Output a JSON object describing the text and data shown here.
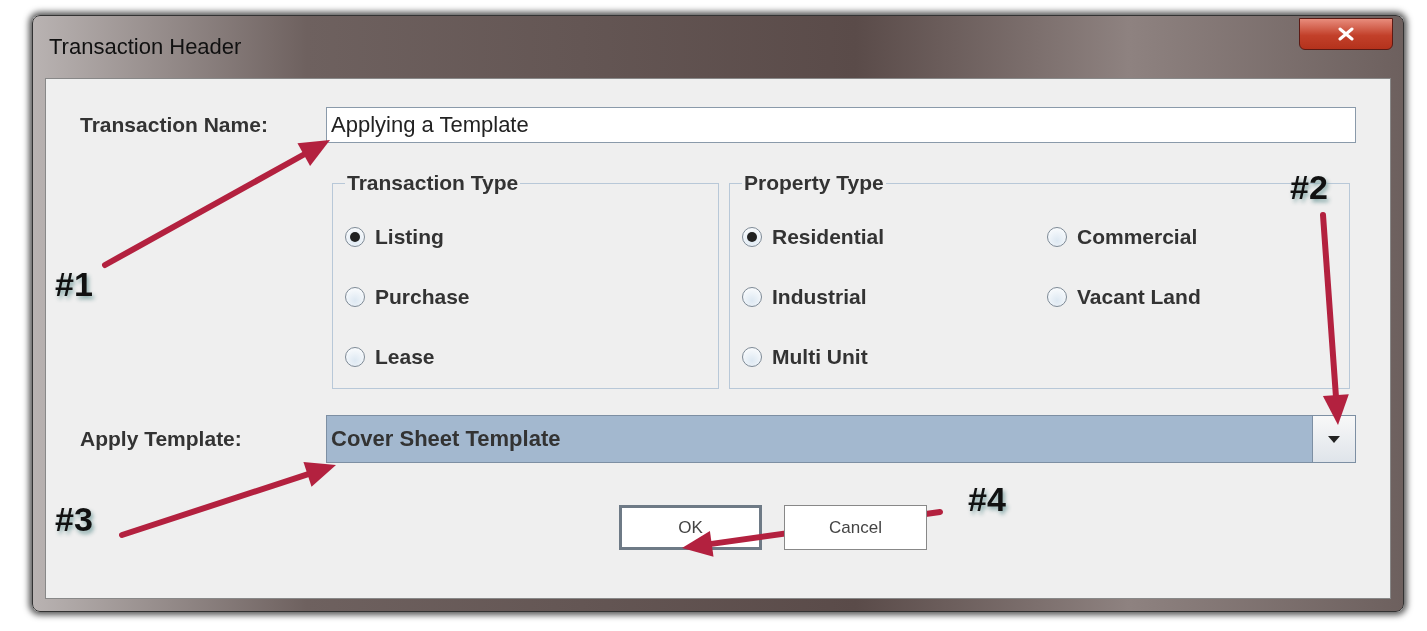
{
  "window": {
    "title": "Transaction Header"
  },
  "transaction_name": {
    "label": "Transaction Name:",
    "value": "Applying a Template"
  },
  "groups": [
    {
      "title": "Transaction Type",
      "options": [
        {
          "label": "Listing",
          "selected": true
        },
        {
          "label": "Purchase",
          "selected": false
        },
        {
          "label": "Lease",
          "selected": false
        }
      ]
    },
    {
      "title": "Property Type",
      "options": [
        {
          "label": "Residential",
          "selected": true
        },
        {
          "label": "Commercial",
          "selected": false
        },
        {
          "label": "Industrial",
          "selected": false
        },
        {
          "label": "Vacant Land",
          "selected": false
        },
        {
          "label": "Multi Unit",
          "selected": false
        }
      ]
    }
  ],
  "apply_template": {
    "label": "Apply Template:",
    "value": "Cover Sheet Template"
  },
  "buttons": [
    {
      "label": "OK",
      "focused": true
    },
    {
      "label": "Cancel",
      "focused": false
    }
  ],
  "annotations": [
    {
      "label": "#1"
    },
    {
      "label": "#2"
    },
    {
      "label": "#3"
    },
    {
      "label": "#4"
    }
  ]
}
